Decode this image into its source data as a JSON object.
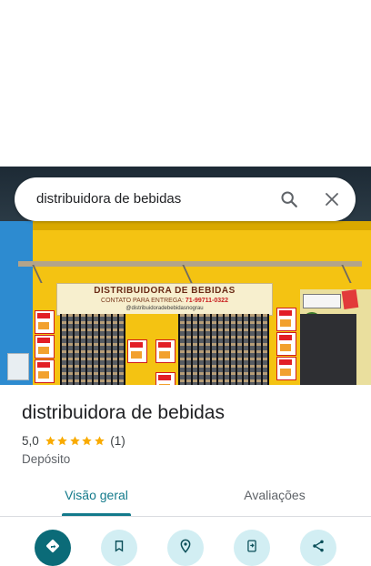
{
  "search": {
    "query": "distribuidora de bebidas",
    "search_icon": "search-icon",
    "close_icon": "close-icon"
  },
  "photo": {
    "sign_title": "DISTRIBUIDORA DE BEBIDAS",
    "sign_contact_label": "CONTATO PARA ENTREGA:",
    "sign_phone": "71-99711-0322",
    "sign_handle": "@distribuidoradebebidasnograu"
  },
  "place": {
    "name": "distribuidora de bebidas",
    "rating": "5,0",
    "stars": 5,
    "review_count": "(1)",
    "category": "Depósito"
  },
  "tabs": [
    {
      "label": "Visão geral",
      "active": true
    },
    {
      "label": "Avaliações",
      "active": false
    }
  ],
  "actions": [
    {
      "icon": "directions-icon"
    },
    {
      "icon": "bookmark-icon"
    },
    {
      "icon": "nearby-icon"
    },
    {
      "icon": "send-to-phone-icon"
    },
    {
      "icon": "share-icon"
    }
  ],
  "colors": {
    "accent": "#137a8b",
    "primary_action": "#0b6b78",
    "secondary_action": "#d2eef3",
    "star": "#f9ab00"
  }
}
